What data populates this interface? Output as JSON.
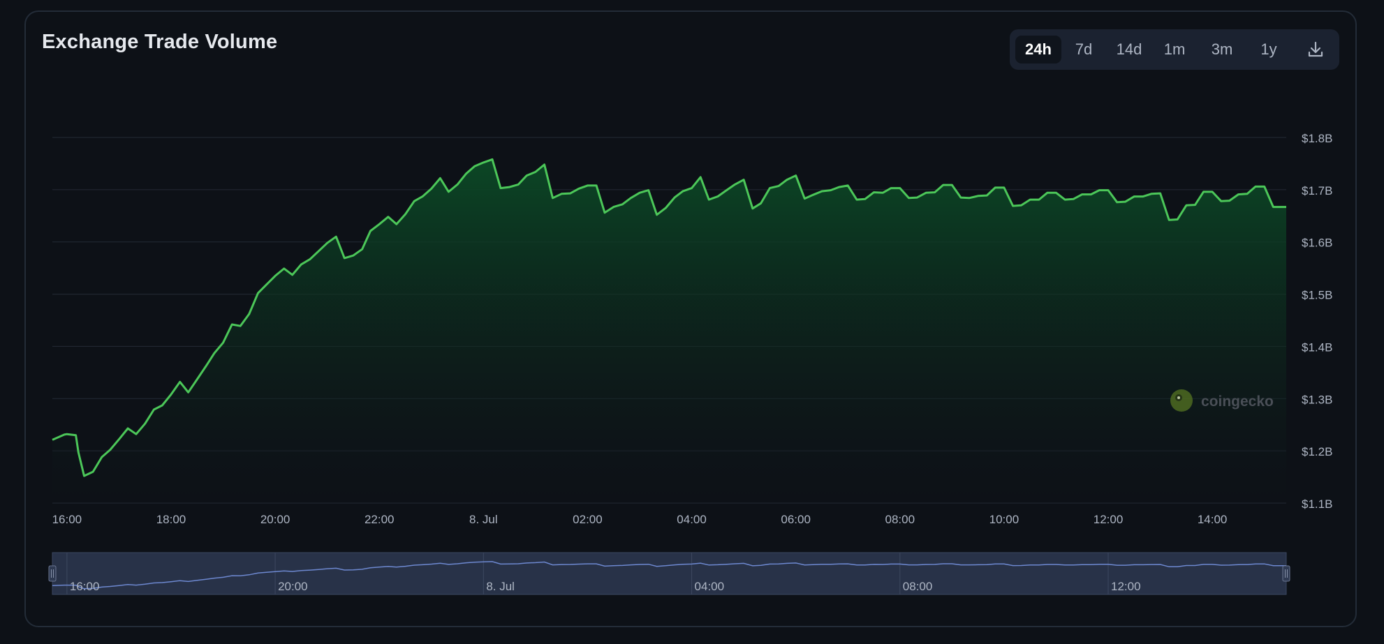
{
  "title": "Exchange Trade Volume",
  "ranges": [
    {
      "label": "24h",
      "active": true
    },
    {
      "label": "7d",
      "active": false
    },
    {
      "label": "14d",
      "active": false
    },
    {
      "label": "1m",
      "active": false
    },
    {
      "label": "3m",
      "active": false
    },
    {
      "label": "1y",
      "active": false
    }
  ],
  "download_icon": "download-icon",
  "watermark": {
    "text": "coingecko",
    "icon": "coingecko-logo"
  },
  "colors": {
    "line": "#4cc759",
    "fill_top": "#0c4a26",
    "navigator_line": "#6d88d0",
    "navigator_bg": "#283248",
    "background": "#0d1117"
  },
  "chart_data": {
    "type": "area",
    "title": "Exchange Trade Volume",
    "xlabel": "",
    "ylabel": "",
    "x_unit": "hours from 16:00 (7 Jul)",
    "xlim": [
      -0.28,
      23.42
    ],
    "ylim": [
      1.1,
      1.8
    ],
    "y_ticks": [
      1.1,
      1.2,
      1.3,
      1.4,
      1.5,
      1.6,
      1.7,
      1.8
    ],
    "y_tick_labels": [
      "$1.1B",
      "$1.2B",
      "$1.3B",
      "$1.4B",
      "$1.5B",
      "$1.6B",
      "$1.7B",
      "$1.8B"
    ],
    "x_ticks": [
      0,
      2,
      4,
      6,
      8,
      10,
      12,
      14,
      16,
      18,
      20,
      22
    ],
    "x_tick_labels": [
      "16:00",
      "18:00",
      "20:00",
      "22:00",
      "8. Jul",
      "02:00",
      "04:00",
      "06:00",
      "08:00",
      "10:00",
      "12:00",
      "14:00"
    ],
    "navigator_ticks": [
      0,
      4,
      8,
      12,
      16,
      20
    ],
    "navigator_labels": [
      "16:00",
      "20:00",
      "8. Jul",
      "04:00",
      "08:00",
      "12:00"
    ],
    "grid": true,
    "legend": "none",
    "series": [
      {
        "unit": "USD billions",
        "values": [
          [
            -0.28,
            1.221
          ],
          [
            -0.05,
            1.231
          ],
          [
            0.0,
            1.232
          ],
          [
            0.17,
            1.23
          ],
          [
            0.22,
            1.197
          ],
          [
            0.33,
            1.152
          ],
          [
            0.5,
            1.16
          ],
          [
            0.67,
            1.188
          ],
          [
            0.83,
            1.202
          ],
          [
            1.0,
            1.222
          ],
          [
            1.17,
            1.243
          ],
          [
            1.33,
            1.232
          ],
          [
            1.5,
            1.252
          ],
          [
            1.67,
            1.279
          ],
          [
            1.83,
            1.287
          ],
          [
            2.0,
            1.308
          ],
          [
            2.17,
            1.332
          ],
          [
            2.33,
            1.312
          ],
          [
            2.5,
            1.337
          ],
          [
            2.67,
            1.362
          ],
          [
            2.83,
            1.387
          ],
          [
            3.0,
            1.407
          ],
          [
            3.17,
            1.442
          ],
          [
            3.33,
            1.439
          ],
          [
            3.5,
            1.462
          ],
          [
            3.67,
            1.502
          ],
          [
            3.83,
            1.518
          ],
          [
            4.0,
            1.535
          ],
          [
            4.17,
            1.549
          ],
          [
            4.33,
            1.537
          ],
          [
            4.5,
            1.557
          ],
          [
            4.67,
            1.567
          ],
          [
            4.83,
            1.582
          ],
          [
            5.0,
            1.598
          ],
          [
            5.17,
            1.61
          ],
          [
            5.33,
            1.569
          ],
          [
            5.5,
            1.574
          ],
          [
            5.67,
            1.586
          ],
          [
            5.83,
            1.621
          ],
          [
            6.0,
            1.634
          ],
          [
            6.17,
            1.648
          ],
          [
            6.33,
            1.634
          ],
          [
            6.5,
            1.653
          ],
          [
            6.67,
            1.678
          ],
          [
            6.83,
            1.687
          ],
          [
            7.0,
            1.702
          ],
          [
            7.17,
            1.722
          ],
          [
            7.33,
            1.696
          ],
          [
            7.5,
            1.71
          ],
          [
            7.67,
            1.731
          ],
          [
            7.83,
            1.745
          ],
          [
            8.0,
            1.752
          ],
          [
            8.17,
            1.758
          ],
          [
            8.33,
            1.703
          ],
          [
            8.5,
            1.705
          ],
          [
            8.67,
            1.71
          ],
          [
            8.83,
            1.727
          ],
          [
            9.0,
            1.734
          ],
          [
            9.17,
            1.748
          ],
          [
            9.33,
            1.684
          ],
          [
            9.5,
            1.692
          ],
          [
            9.67,
            1.693
          ],
          [
            9.83,
            1.702
          ],
          [
            10.0,
            1.708
          ],
          [
            10.17,
            1.708
          ],
          [
            10.33,
            1.656
          ],
          [
            10.5,
            1.667
          ],
          [
            10.67,
            1.672
          ],
          [
            10.83,
            1.684
          ],
          [
            11.0,
            1.694
          ],
          [
            11.17,
            1.699
          ],
          [
            11.33,
            1.652
          ],
          [
            11.5,
            1.665
          ],
          [
            11.67,
            1.685
          ],
          [
            11.83,
            1.697
          ],
          [
            12.0,
            1.703
          ],
          [
            12.17,
            1.724
          ],
          [
            12.33,
            1.681
          ],
          [
            12.5,
            1.687
          ],
          [
            12.67,
            1.699
          ],
          [
            12.83,
            1.71
          ],
          [
            13.0,
            1.719
          ],
          [
            13.17,
            1.664
          ],
          [
            13.33,
            1.674
          ],
          [
            13.5,
            1.703
          ],
          [
            13.67,
            1.707
          ],
          [
            13.83,
            1.719
          ],
          [
            14.0,
            1.727
          ],
          [
            14.17,
            1.683
          ],
          [
            14.33,
            1.69
          ],
          [
            14.5,
            1.697
          ],
          [
            14.67,
            1.699
          ],
          [
            14.83,
            1.705
          ],
          [
            15.0,
            1.708
          ],
          [
            15.17,
            1.681
          ],
          [
            15.33,
            1.682
          ],
          [
            15.5,
            1.695
          ],
          [
            15.67,
            1.694
          ],
          [
            15.83,
            1.703
          ],
          [
            16.0,
            1.703
          ],
          [
            16.17,
            1.684
          ],
          [
            16.33,
            1.685
          ],
          [
            16.5,
            1.694
          ],
          [
            16.67,
            1.695
          ],
          [
            16.83,
            1.709
          ],
          [
            17.0,
            1.709
          ],
          [
            17.17,
            1.685
          ],
          [
            17.33,
            1.684
          ],
          [
            17.5,
            1.688
          ],
          [
            17.67,
            1.689
          ],
          [
            17.83,
            1.704
          ],
          [
            18.0,
            1.704
          ],
          [
            18.17,
            1.669
          ],
          [
            18.33,
            1.67
          ],
          [
            18.5,
            1.681
          ],
          [
            18.67,
            1.681
          ],
          [
            18.83,
            1.694
          ],
          [
            19.0,
            1.694
          ],
          [
            19.17,
            1.681
          ],
          [
            19.33,
            1.682
          ],
          [
            19.5,
            1.691
          ],
          [
            19.67,
            1.691
          ],
          [
            19.83,
            1.699
          ],
          [
            20.0,
            1.699
          ],
          [
            20.17,
            1.676
          ],
          [
            20.33,
            1.677
          ],
          [
            20.5,
            1.687
          ],
          [
            20.67,
            1.687
          ],
          [
            20.83,
            1.692
          ],
          [
            21.0,
            1.693
          ],
          [
            21.17,
            1.642
          ],
          [
            21.33,
            1.643
          ],
          [
            21.5,
            1.67
          ],
          [
            21.67,
            1.671
          ],
          [
            21.83,
            1.696
          ],
          [
            22.0,
            1.696
          ],
          [
            22.17,
            1.678
          ],
          [
            22.33,
            1.679
          ],
          [
            22.5,
            1.691
          ],
          [
            22.67,
            1.692
          ],
          [
            22.83,
            1.706
          ],
          [
            23.0,
            1.706
          ],
          [
            23.17,
            1.667
          ],
          [
            23.42,
            1.667
          ]
        ]
      }
    ]
  }
}
